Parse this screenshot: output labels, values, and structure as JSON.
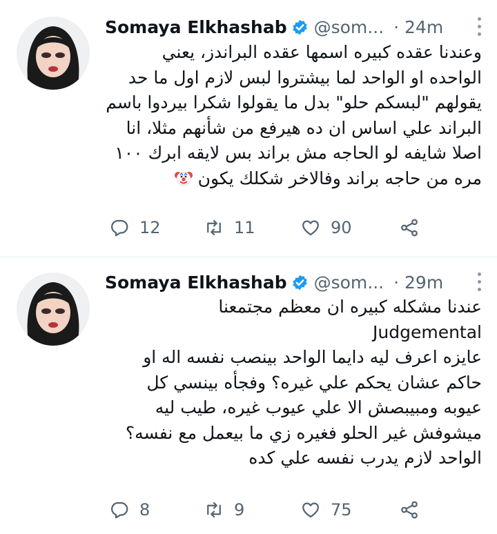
{
  "tweets": [
    {
      "author_name": "Somaya Elkhashab",
      "handle": "@som...",
      "time": "· 24m",
      "lines": [
        "وعندنا عقده كبيره اسمها عقده البراندز، يعني",
        "الواحده او الواحد لما بيشتروا لبس لازم اول ما حد",
        "يقولهم \"لبسكم حلو\" بدل ما يقولوا شكرا بيردوا باسم",
        "البراند علي اساس ان ده هيرفع من شأنهم مثلا، انا",
        "اصلا شايفه لو الحاجه مش براند بس لايقه ابرك ١٠٠",
        "مره من حاجه براند وفالاخر شكلك يكون"
      ],
      "emoji": "clown-face",
      "replies": "12",
      "retweets": "11",
      "likes": "90"
    },
    {
      "author_name": "Somaya Elkhashab",
      "handle": "@som...",
      "time": "· 29m",
      "lines": [
        "عندنا مشكله كبيره ان معظم مجتمعنا",
        "Judgemental",
        "عايزه اعرف ليه دايما الواحد بينصب نفسه اله او",
        "حاكم عشان يحكم علي غيره؟ وفجأه بينسي كل",
        "عيوبه ومبيبصش الا علي عيوب غيره، طيب ليه",
        "ميشوفش غير الحلو فغيره زي ما بيعمل مع نفسه؟",
        "الواحد لازم يدرب نفسه علي كده"
      ],
      "replies": "8",
      "retweets": "9",
      "likes": "75"
    }
  ],
  "icons": {
    "verified": "verified-badge-icon",
    "more": "more-icon",
    "reply": "reply-icon",
    "retweet": "retweet-icon",
    "like": "like-icon",
    "share": "share-icon"
  },
  "colors": {
    "verified_blue": "#1d9bf0",
    "secondary_text": "#536471",
    "divider": "#e6ecf0"
  }
}
